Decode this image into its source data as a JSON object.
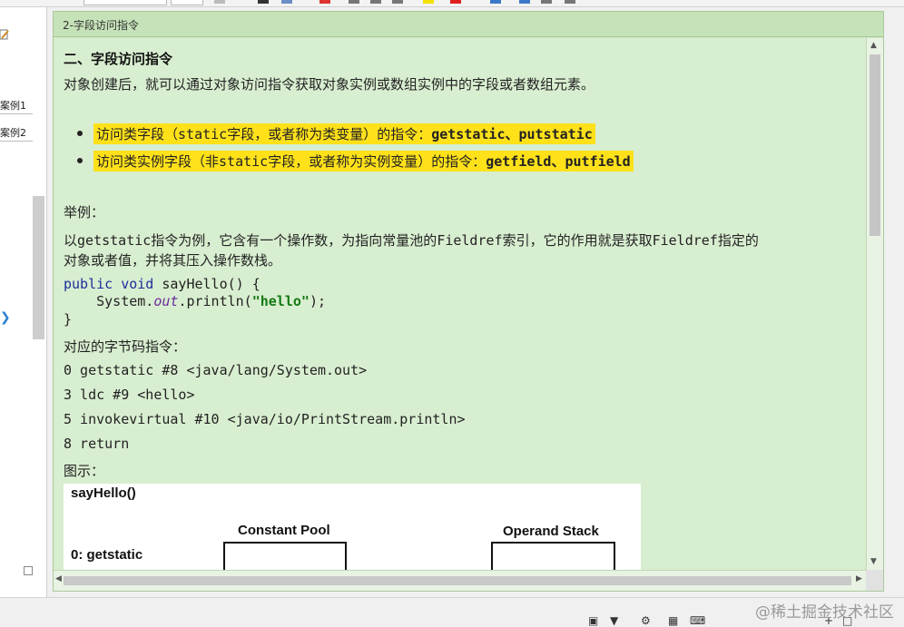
{
  "sidebar": {
    "items": [
      {
        "label": "案例1"
      },
      {
        "label": "案例2"
      }
    ]
  },
  "note": {
    "title": "2-字段访问指令",
    "heading": "二、字段访问指令",
    "intro": "对象创建后，就可以通过对象访问指令获取对象实例或数组实例中的字段或者数组元素。",
    "bullets": [
      {
        "pre": "访问类字段（",
        "code": "static",
        "post": "字段，或者称为类变量）的指令：",
        "tail": "getstatic、putstatic"
      },
      {
        "pre": "访问类实例字段（非",
        "code": "static",
        "post": "字段，或者称为实例变量）的指令：",
        "tail": "getfield、putfield"
      }
    ],
    "example_label": "举例：",
    "example_text_1a": "以",
    "example_text_1b": "getstatic",
    "example_text_1c": "指令为例，它含有一个操作数，为指向常量池的",
    "example_text_1d": "Fieldref",
    "example_text_1e": "索引，它的作用就是获取",
    "example_text_1f": "Fieldref",
    "example_text_1g": "指定的",
    "example_text_2": "对象或者值，并将其压入操作数栈。",
    "code": {
      "l1_kw1": "public",
      "l1_kw2": "void",
      "l1_rest": " sayHello() {",
      "l2_a": "    System.",
      "l2_it": "out",
      "l2_b": ".println(",
      "l2_str": "\"hello\"",
      "l2_c": ");",
      "l3": "}"
    },
    "bytecode_label": "对应的字节码指令：",
    "bytecode": [
      "0 getstatic #8 <java/lang/System.out>",
      "3 ldc #9 <hello>",
      "5 invokevirtual #10 <java/io/PrintStream.println>",
      "8 return"
    ],
    "figure_label": "图示：",
    "diagram": {
      "method": "sayHello()",
      "pool": "Constant Pool",
      "stack": "Operand Stack",
      "step": "0: getstatic"
    }
  },
  "watermark": "@稀土掘金技术社区",
  "colors": {
    "note_bg": "#d8eed0",
    "highlight": "#ffe11a",
    "keyword": "#1c2d9c",
    "string": "#137a13"
  }
}
